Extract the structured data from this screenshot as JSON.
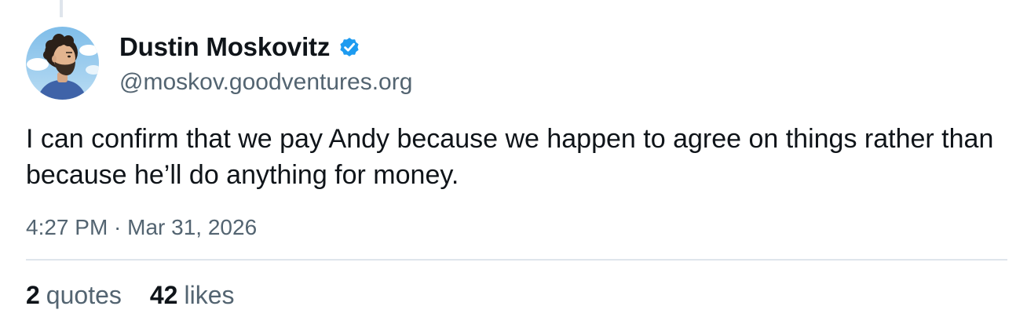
{
  "author": {
    "display_name": "Dustin Moskovitz",
    "handle": "@moskov.goodventures.org",
    "verified": true,
    "avatar_icon": "avatar-illustration"
  },
  "post": {
    "text": "I can confirm that we pay Andy because we happen to agree on things rather than because he’ll do anything for money.",
    "timestamp": "4:27 PM · Mar 31, 2026"
  },
  "stats": {
    "quotes_count": "2",
    "quotes_label": "quotes",
    "likes_count": "42",
    "likes_label": "likes"
  },
  "colors": {
    "verified_blue": "#1d9bf0",
    "muted_text": "#536471",
    "primary_text": "#0f1419",
    "divider": "#dfe5ec"
  }
}
